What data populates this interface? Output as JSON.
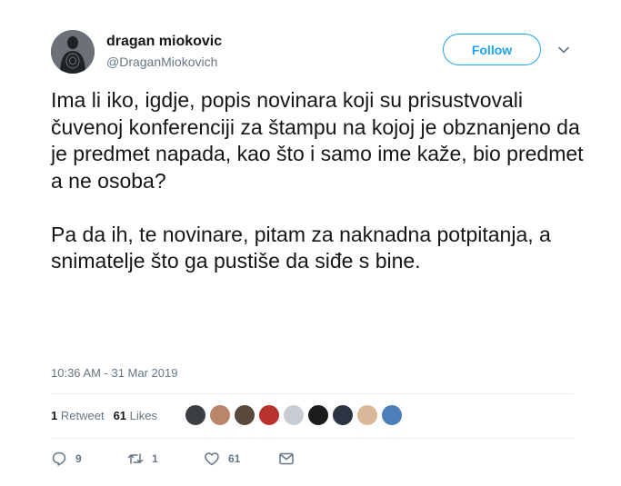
{
  "author": {
    "name": "dragan miokovic",
    "handle": "@DraganMiokovich"
  },
  "follow_label": "Follow",
  "tweet": {
    "paragraphs": [
      "Ima li iko, igdje, popis novinara koji su prisustvovali čuvenoj konferenciji za štampu na kojoj je obznanjeno da je predmet napada, kao što i samo ime kaže, bio predmet a ne osoba?",
      "Pa da ih, te novinare, pitam za naknadna potpitanja, a snimatelje što ga pustiše da siđe s bine."
    ],
    "timestamp": "10:36 AM - 31 Mar 2019"
  },
  "stats": {
    "retweets_count": "1",
    "retweets_label": "Retweet",
    "likes_count": "61",
    "likes_label": "Likes"
  },
  "liker_colors": [
    "#3a3f44",
    "#b9866c",
    "#5a4a3e",
    "#b7332b",
    "#c7cdd2",
    "#1c1c1c",
    "#2a3442",
    "#d9b89a",
    "#4c7fb8"
  ],
  "actions": {
    "reply_count": "9",
    "retweet_count": "1",
    "like_count": "61"
  },
  "colors": {
    "accent": "#1da1f2",
    "secondary_text": "#657786",
    "divider": "#e6ecf0"
  }
}
